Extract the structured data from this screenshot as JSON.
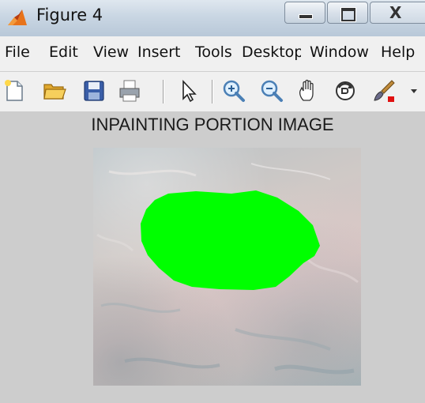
{
  "window": {
    "title": "Figure 4",
    "close_glyph": "X"
  },
  "menu": {
    "items": [
      "File",
      "Edit",
      "View",
      "Insert",
      "Tools",
      "Desktop",
      "Window",
      "Help"
    ]
  },
  "toolbar": {
    "tools": [
      "new-file-icon",
      "open-folder-icon",
      "save-icon",
      "print-icon",
      "pointer-icon",
      "zoom-in-icon",
      "zoom-out-icon",
      "pan-hand-icon",
      "rotate-3d-icon",
      "data-brush-icon"
    ]
  },
  "figure": {
    "title": "INPAINTING PORTION IMAGE",
    "mask_color": "#00ff00"
  }
}
